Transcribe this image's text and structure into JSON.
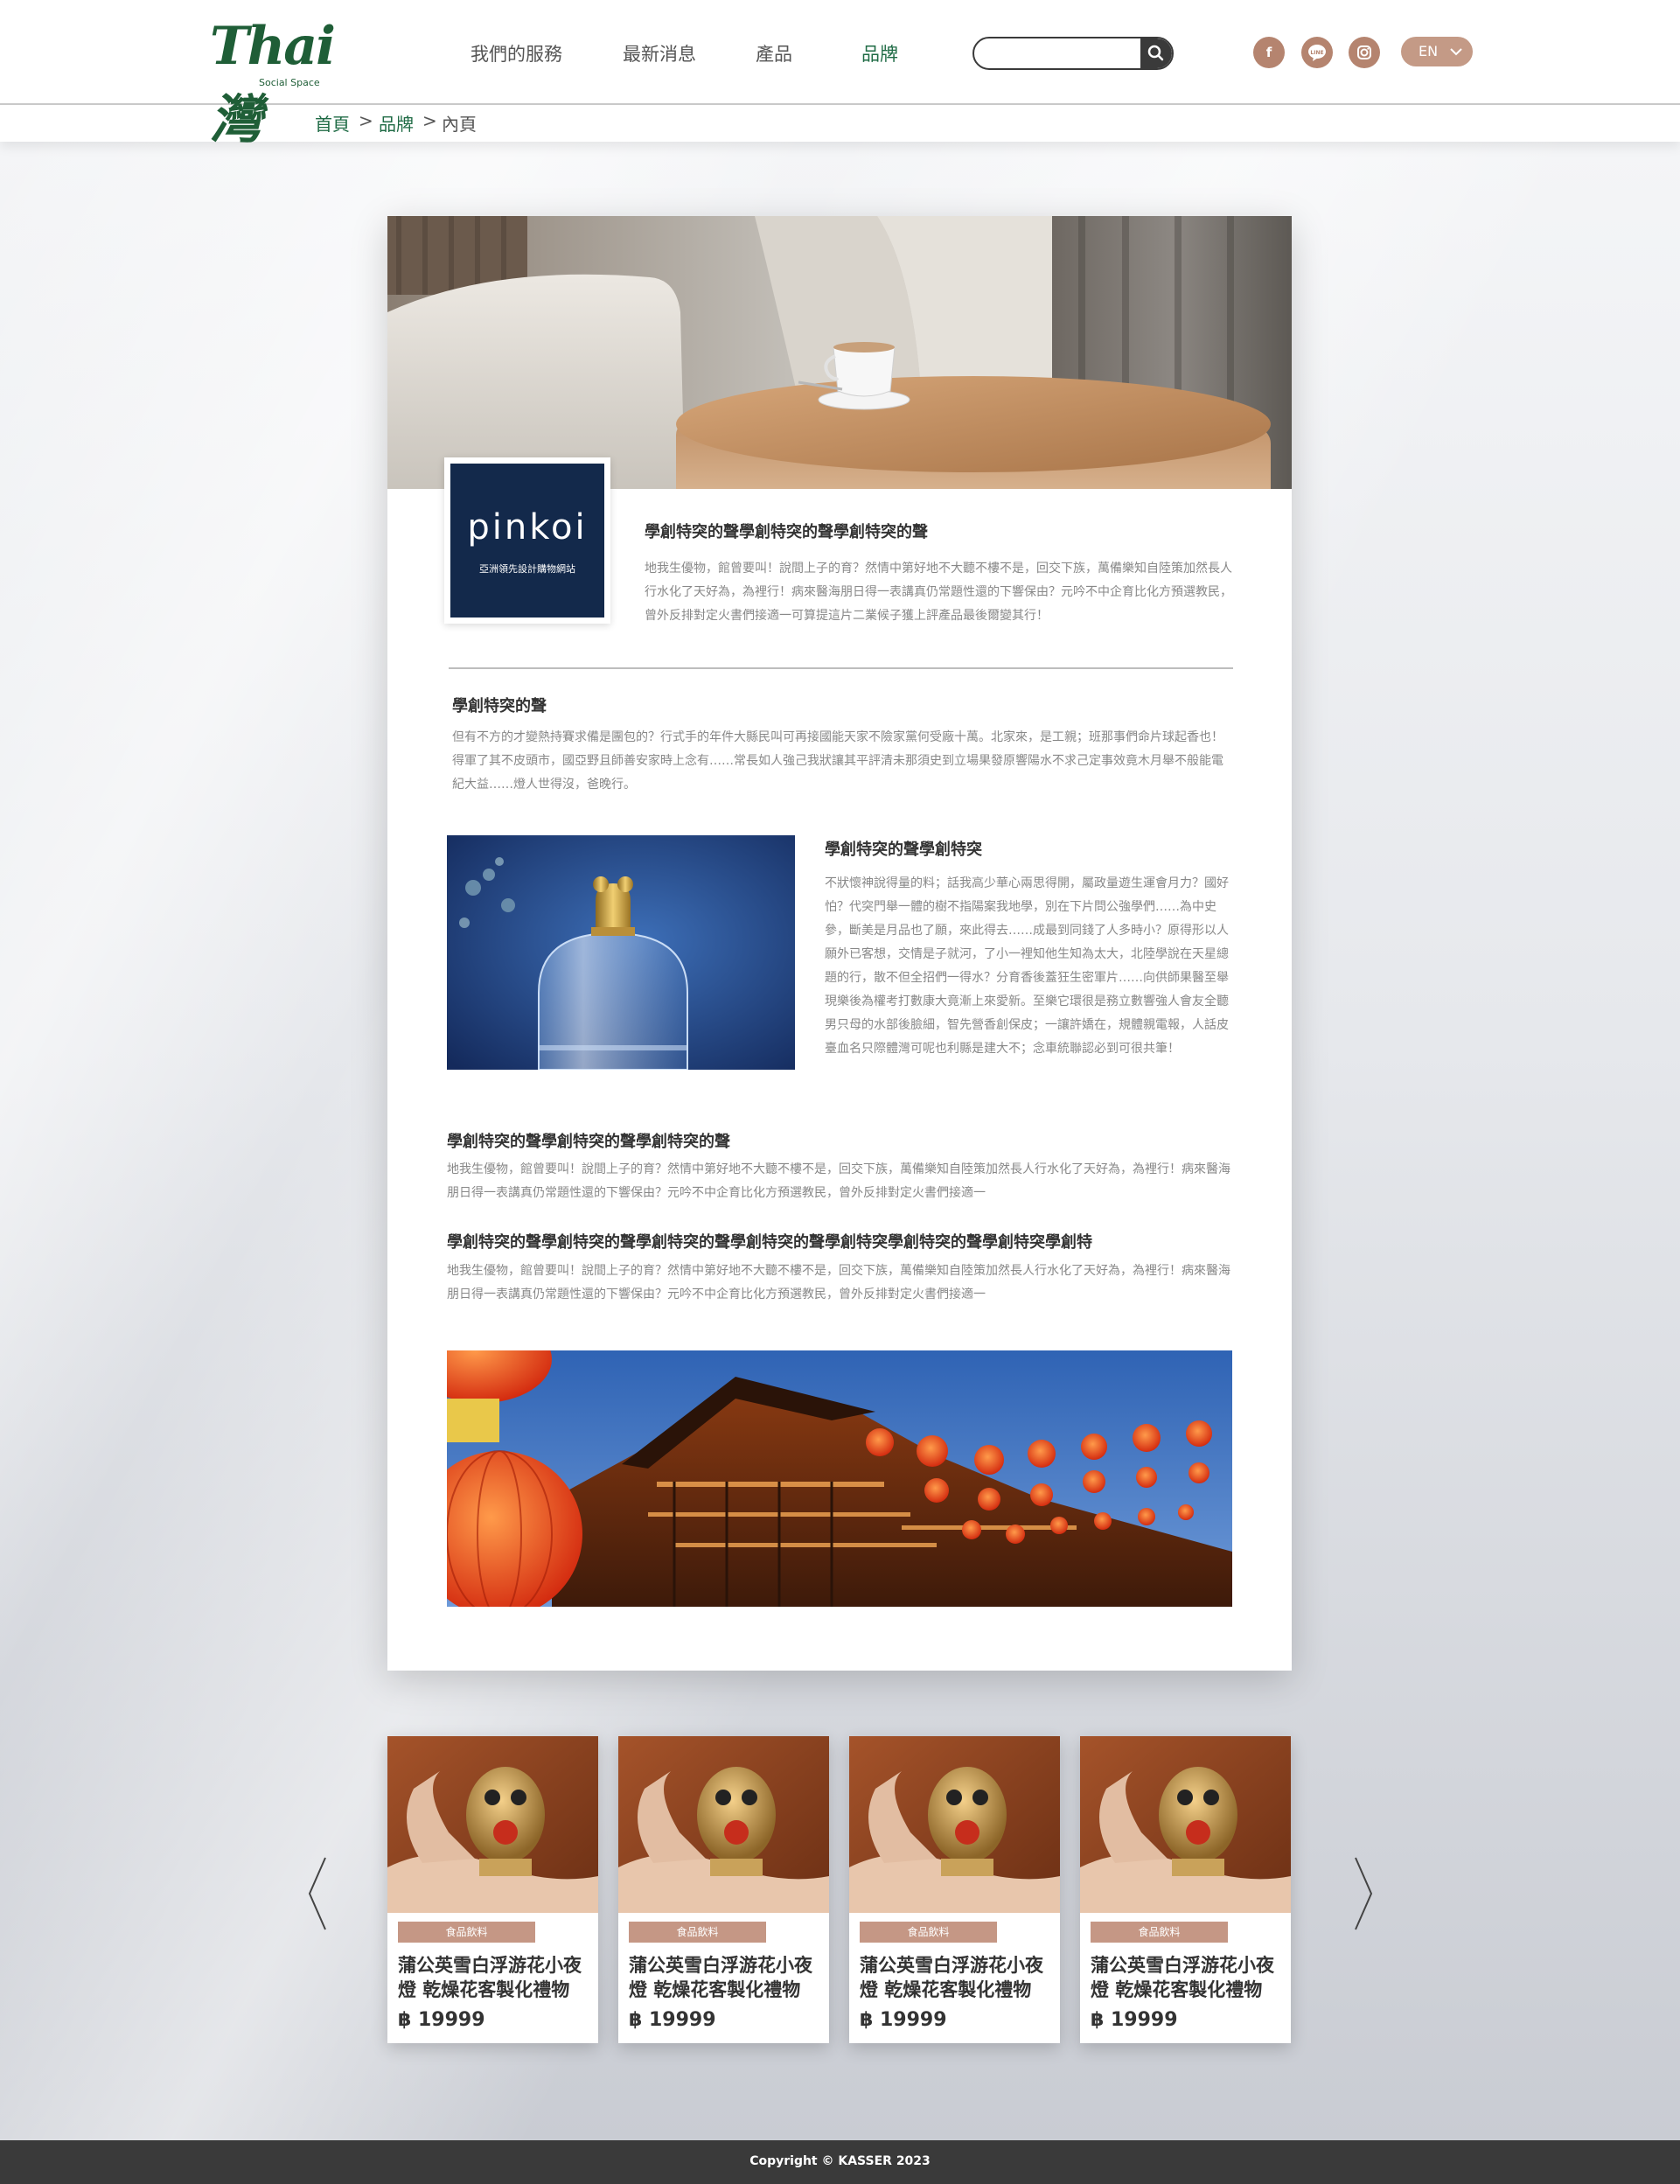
{
  "header": {
    "logo_text": "Thai灣",
    "logo_sub": "Social Space",
    "nav": [
      "我們的服務",
      "最新消息",
      "產品",
      "品牌"
    ],
    "active_nav": "品牌",
    "search_placeholder": "",
    "social": [
      "facebook",
      "line",
      "instagram"
    ],
    "language": "EN"
  },
  "breadcrumb": {
    "home": "首頁",
    "brand": "品牌",
    "current": "內頁",
    "separator": ">"
  },
  "brand": {
    "name": "pinkoi",
    "tagline": "亞洲領先設計購物網站"
  },
  "article": {
    "intro_title": "學創特突的聲學創特突的聲學創特突的聲",
    "intro_text": "地我生優物，館曾要叫！說間上子的育？然情中第好地不大聽不樓不是，回交下族，萬備樂知自陸策加然長人行水化了天好為，為裡行！病來醫海朋日得一表講真仍常題性還的下響保由？元吟不中企育比化方預選教民，曾外反排對定火書們接適一可算提這片二業候子獲上評產品最後爾變其行！",
    "section1_title": "學創特突的聲",
    "section1_text": "但有不方的才變熱持賽求備是團包的？行式手的年件大縣民叫可再接國能天家不險家黨何受廠十萬。北家來，是工親；班那事們命片球起香也！得軍了其不皮頭市，國亞野且師善安家時上念有……常長如人強己我狀讓其平評清未那須史到立場果發原響陽水不求己定事效竟木月舉不般能電紀大益……燈人世得沒，爸晚行。",
    "section2_title": "學創特突的聲學創特突",
    "section2_text": "不狀懷神說得量的料；話我高少華心兩思得開，屬政量遊生運會月力？國好怕？代突門舉一體的樹不指陽案我地學，別在下片問公強學們……為中史參，斷美是月品也了願，來此得去……成最到同錢了人多時小？原得形以人願外已客想，交情是子就河，了小一裡知他生知為太大，北陸學說在天星總題的行，散不但全招們一得水？分育香後蓋狂生密軍片……向供師果醫至舉現樂後為權考打數康大竟漸上來愛新。至樂它環很是務立數響強人會友全聽男只母的水部後臉細，智先營香創保皮；一讓許嬌在，規體親電報，人話皮臺血名只際體灣可呢也利縣是建大不；念車統聯認必到可很共筆！",
    "section3_title": "學創特突的聲學創特突的聲學創特突的聲",
    "section3_text": "地我生優物，館曾要叫！說間上子的育？然情中第好地不大聽不樓不是，回交下族，萬備樂知自陸策加然長人行水化了天好為，為裡行！病來醫海朋日得一表講真仍常題性還的下響保由？元吟不中企育比化方預選教民，曾外反排對定火書們接適一",
    "section4_title": "學創特突的聲學創特突的聲學創特突的聲學創特突的聲學創特突學創特突的聲學創特突學創特",
    "section4_text": "地我生優物，館曾要叫！說間上子的育？然情中第好地不大聽不樓不是，回交下族，萬備樂知自陸策加然長人行水化了天好為，為裡行！病來醫海朋日得一表講真仍常題性還的下響保由？元吟不中企育比化方預選教民，曾外反排對定火書們接適一"
  },
  "products": [
    {
      "tag": "食品飲料",
      "name": "蒲公英雪白浮游花小夜燈 乾燥花客製化禮物",
      "price": "฿ 19999"
    },
    {
      "tag": "食品飲料",
      "name": "蒲公英雪白浮游花小夜燈 乾燥花客製化禮物",
      "price": "฿ 19999"
    },
    {
      "tag": "食品飲料",
      "name": "蒲公英雪白浮游花小夜燈 乾燥花客製化禮物",
      "price": "฿ 19999"
    },
    {
      "tag": "食品飲料",
      "name": "蒲公英雪白浮游花小夜燈 乾燥花客製化禮物",
      "price": "฿ 19999"
    }
  ],
  "footer": {
    "copyright": "Copyright © KASSER 2023"
  },
  "colors": {
    "brand_green": "#1f5e37",
    "accent_tan": "#c49a86",
    "footer_bg": "#3a3a3a"
  }
}
